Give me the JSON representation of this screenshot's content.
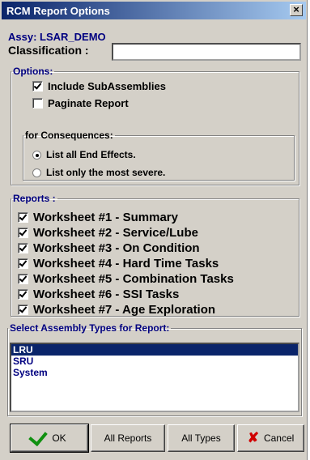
{
  "window": {
    "title": "RCM Report Options",
    "close_label": "×"
  },
  "assy": "Assy: LSAR_DEMO",
  "classification": {
    "label": "Classification :",
    "value": ""
  },
  "options": {
    "legend": "Options:",
    "include_subassemblies": {
      "label": "Include SubAssemblies",
      "checked": true
    },
    "paginate_report": {
      "label": "Paginate Report",
      "checked": false
    }
  },
  "consequences": {
    "legend": "for Consequences:",
    "all": {
      "label": "List all End Effects.",
      "checked": true
    },
    "severe": {
      "label": "List only the most severe.",
      "checked": false
    }
  },
  "reports": {
    "legend": "Reports :",
    "items": [
      {
        "label": "Worksheet #1 - Summary",
        "checked": true
      },
      {
        "label": "Worksheet #2 - Service/Lube",
        "checked": true
      },
      {
        "label": "Worksheet #3 - On Condition",
        "checked": true
      },
      {
        "label": "Worksheet #4 - Hard Time Tasks",
        "checked": true
      },
      {
        "label": "Worksheet #5 - Combination Tasks",
        "checked": true
      },
      {
        "label": "Worksheet #6 - SSI Tasks",
        "checked": true
      },
      {
        "label": "Worksheet #7 - Age Exploration",
        "checked": true
      }
    ]
  },
  "assembly_types": {
    "legend": "Select Assembly Types for Report:",
    "items": [
      {
        "label": "LRU",
        "selected": true
      },
      {
        "label": "SRU",
        "selected": false
      },
      {
        "label": "System",
        "selected": false
      }
    ]
  },
  "buttons": {
    "ok": "OK",
    "all_reports": "All Reports",
    "all_types": "All Types",
    "cancel": "Cancel"
  },
  "colors": {
    "title_start": "#0a246a",
    "title_end": "#a6caf0",
    "accent_blue": "#000080",
    "selection": "#0a246a",
    "face": "#d4d0c8",
    "ok_green": "#109010",
    "cancel_red": "#d00000"
  }
}
